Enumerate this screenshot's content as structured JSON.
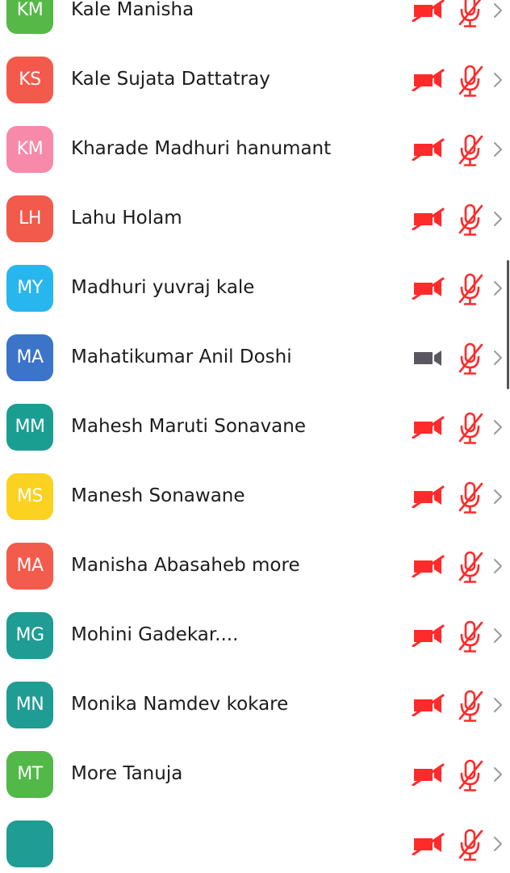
{
  "colors": {
    "muted_red": "#ff2a2a",
    "camera_on_gray": "#5b5760",
    "chevron_gray": "#9a9a9a"
  },
  "participants": [
    {
      "initials": "KM",
      "name": "Kale Manisha",
      "avatar_color": "#56b947",
      "video": "off",
      "audio": "muted"
    },
    {
      "initials": "KS",
      "name": "Kale Sujata Dattatray",
      "avatar_color": "#f45a4c",
      "video": "off",
      "audio": "muted"
    },
    {
      "initials": "KM",
      "name": "Kharade Madhuri hanumant",
      "avatar_color": "#f78aaa",
      "video": "off",
      "audio": "muted"
    },
    {
      "initials": "LH",
      "name": "Lahu Holam",
      "avatar_color": "#f25a4c",
      "video": "off",
      "audio": "muted"
    },
    {
      "initials": "MY",
      "name": "Madhuri yuvraj kale",
      "avatar_color": "#28b6ee",
      "video": "off",
      "audio": "muted"
    },
    {
      "initials": "MA",
      "name": "Mahatikumar Anil Doshi",
      "avatar_color": "#3b74c8",
      "video": "on",
      "audio": "muted"
    },
    {
      "initials": "MM",
      "name": "Mahesh Maruti Sonavane",
      "avatar_color": "#1b9e92",
      "video": "off",
      "audio": "muted"
    },
    {
      "initials": "MS",
      "name": "Manesh Sonawane",
      "avatar_color": "#fbd21f",
      "video": "off",
      "audio": "muted"
    },
    {
      "initials": "MA",
      "name": "Manisha Abasaheb more",
      "avatar_color": "#f35b4d",
      "video": "off",
      "audio": "muted"
    },
    {
      "initials": "MG",
      "name": "Mohini Gadekar....",
      "avatar_color": "#1f9c93",
      "video": "off",
      "audio": "muted"
    },
    {
      "initials": "MN",
      "name": "Monika Namdev kokare",
      "avatar_color": "#1f9c93",
      "video": "off",
      "audio": "muted"
    },
    {
      "initials": "MT",
      "name": "More Tanuja",
      "avatar_color": "#52b848",
      "video": "off",
      "audio": "muted"
    },
    {
      "initials": "",
      "name": "",
      "avatar_color": "#1f9c93",
      "video": "off",
      "audio": "muted"
    }
  ]
}
